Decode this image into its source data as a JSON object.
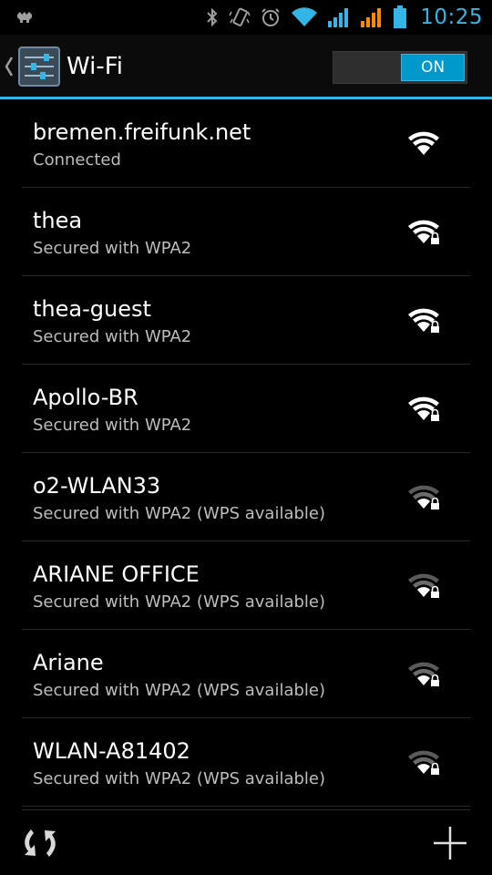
{
  "status_bar": {
    "time": "10:25",
    "icons": [
      "notification-icon",
      "bluetooth-icon",
      "vibrate-icon",
      "alarm-icon",
      "wifi-status-icon",
      "signal-bars-blue-icon",
      "signal-bars-orange-icon",
      "battery-icon"
    ],
    "accent_color": "#33b5e5",
    "warning_color": "#ff8800"
  },
  "action_bar": {
    "title": "Wi-Fi",
    "toggle_label": "ON",
    "toggle_state": "on",
    "accent_color": "#33b5e5"
  },
  "networks": [
    {
      "ssid": "bremen.freifunk.net",
      "summary": "Connected",
      "secured": false,
      "signal": "strong"
    },
    {
      "ssid": "thea",
      "summary": "Secured with WPA2",
      "secured": true,
      "signal": "strong"
    },
    {
      "ssid": "thea-guest",
      "summary": "Secured with WPA2",
      "secured": true,
      "signal": "strong"
    },
    {
      "ssid": "Apollo-BR",
      "summary": "Secured with WPA2",
      "secured": true,
      "signal": "strong"
    },
    {
      "ssid": "o2-WLAN33",
      "summary": "Secured with WPA2 (WPS available)",
      "secured": true,
      "signal": "weak"
    },
    {
      "ssid": "ARIANE OFFICE",
      "summary": "Secured with WPA2 (WPS available)",
      "secured": true,
      "signal": "weak"
    },
    {
      "ssid": "Ariane",
      "summary": "Secured with WPA2 (WPS available)",
      "secured": true,
      "signal": "weak"
    },
    {
      "ssid": "WLAN-A81402",
      "summary": "Secured with WPA2 (WPS available)",
      "secured": true,
      "signal": "weak"
    }
  ],
  "bottom_bar": {
    "icons": [
      "scan-icon",
      "add-network-icon"
    ]
  }
}
